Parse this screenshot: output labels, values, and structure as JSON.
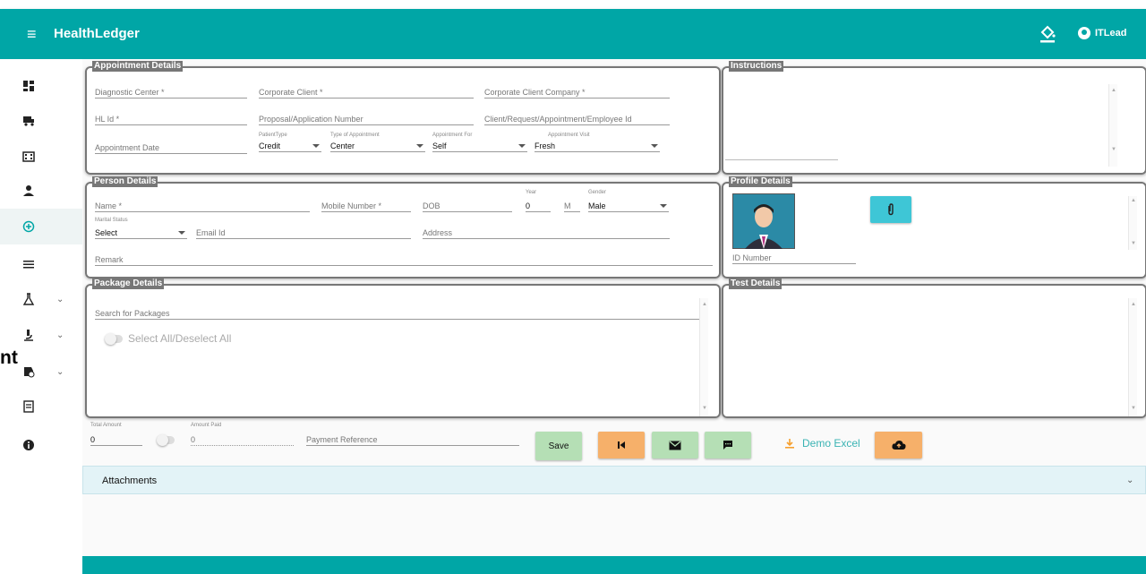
{
  "app": {
    "title": "HealthLedger",
    "user": "ITLead"
  },
  "sidebar": {
    "overlay_text": "nt",
    "items": [
      {
        "icon": "dashboard-icon"
      },
      {
        "icon": "truck-icon"
      },
      {
        "icon": "building-icon"
      },
      {
        "icon": "person-icon"
      },
      {
        "icon": "add-circle-icon"
      },
      {
        "icon": "list-icon"
      },
      {
        "icon": "flask-icon"
      },
      {
        "icon": "microscope-icon"
      },
      {
        "icon": "hospital-icon"
      },
      {
        "icon": "document-icon"
      },
      {
        "icon": "info-icon"
      }
    ]
  },
  "appointment": {
    "legend": "Appointment Details",
    "diagnostic_center": "Diagnostic Center *",
    "corporate_client": "Corporate Client *",
    "corporate_client_company": "Corporate Client Company *",
    "hl_id": "HL Id *",
    "proposal_number": "Proposal/Application Number",
    "client_request_id": "Client/Request/Appointment/Employee Id",
    "appointment_date": "Appointment Date",
    "patient_type_label": "PatientType",
    "patient_type_value": "Credit",
    "type_of_appointment_label": "Type of Appointment",
    "type_of_appointment_value": "Center",
    "appointment_for_label": "Appointment For",
    "appointment_for_value": "Self",
    "appointment_visit_label": "Appointment Visit",
    "appointment_visit_value": "Fresh"
  },
  "instructions": {
    "legend": "Instructions"
  },
  "person": {
    "legend": "Person Details",
    "name": "Name *",
    "mobile": "Mobile Number *",
    "dob": "DOB",
    "year_label": "Year",
    "year_value": "0",
    "m_label": "M",
    "gender_label": "Gender",
    "gender_value": "Male",
    "marital_label": "Marital Status",
    "marital_value": "Select",
    "email": "Email Id",
    "address": "Address",
    "remark": "Remark"
  },
  "profile": {
    "legend": "Profile Details",
    "id_number": "ID Number"
  },
  "package": {
    "legend": "Package Details",
    "search": "Search for Packages",
    "select_all": "Select All/Deselect All"
  },
  "test": {
    "legend": "Test Details"
  },
  "payment": {
    "total_label": "Total Amount",
    "total_value": "0",
    "paid_label": "Amount Paid",
    "paid_value": "0",
    "reference": "Payment Reference"
  },
  "actions": {
    "save": "Save",
    "demo_excel": "Demo Excel"
  },
  "attachments": {
    "label": "Attachments"
  },
  "colors": {
    "brand": "#00a6a6",
    "save": "#b5dfb5",
    "orange": "#f6b06a",
    "attach_btn": "#3ec6d6"
  }
}
